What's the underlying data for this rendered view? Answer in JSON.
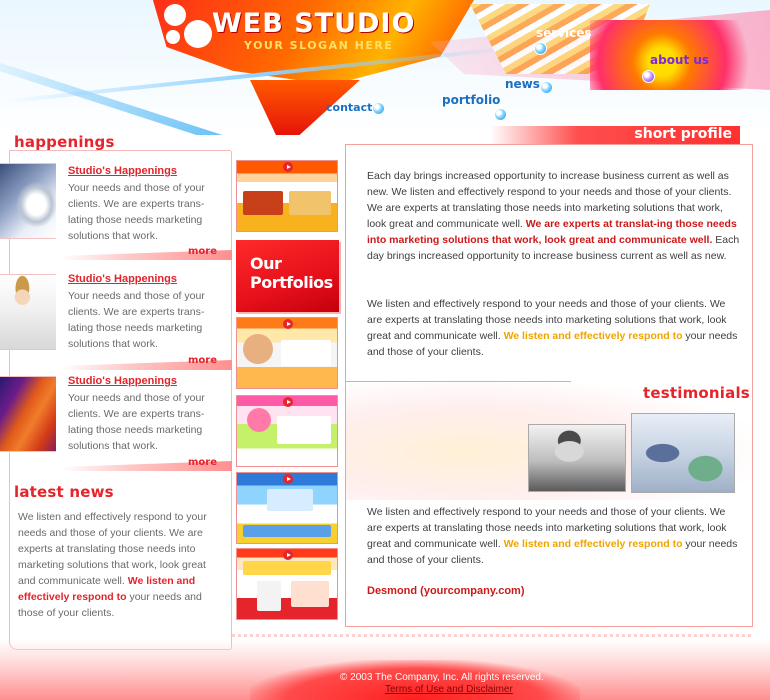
{
  "logo": {
    "title": "WEB STUDIO",
    "slogan": "YOUR SLOGAN HERE"
  },
  "nav": {
    "services": "services",
    "about_us": "about us",
    "news": "news",
    "portfolio": "portfolio",
    "contact": "contact"
  },
  "short_profile": {
    "heading": "short profile",
    "para1_a": "Each day brings increased opportunity to increase business current as well as new.  We listen and effectively respond to your needs and those of your clients. We are experts at translating those needs into marketing solutions that work, look great and communicate well.  ",
    "para1_b": "We are experts at translat-ing  those needs into marketing solutions that work, look great and communicate well.",
    "para1_c": " Each day brings increased opportunity to increase business current as well as new.",
    "para2_a": "We listen and effectively respond to your needs and those of your clients. We are experts at translating those needs into marketing solutions that work, look great and communicate well.  ",
    "para2_b": "We listen and effectively respond to",
    "para2_c": " your needs and those of your clients."
  },
  "testimonials": {
    "heading": "testimonials",
    "text_a": "We listen and effectively respond to your needs and those of your clients. We are experts at translating those needs into marketing solutions that work, look great and communicate well.  ",
    "text_b": "We listen and effectively respond to",
    "text_c": " your needs and those of your clients.",
    "signature": "Desmond (yourcompany.com)"
  },
  "happenings": {
    "heading": "happenings",
    "items": [
      {
        "title": "Studio's Happenings",
        "text": "Your needs and those of your clients. We are experts trans-lating those needs marketing solutions that work.",
        "more": "more"
      },
      {
        "title": "Studio's Happenings",
        "text": "Your needs and those of your clients. We are experts trans-lating those needs marketing solutions that work.",
        "more": "more"
      },
      {
        "title": "Studio's Happenings",
        "text": "Your needs and those of your clients. We are experts trans-lating those needs marketing solutions that work.",
        "more": "more"
      }
    ]
  },
  "latest_news": {
    "heading": "latest news",
    "text_a": "We listen and effectively respond to your needs and those of your clients. We are experts at translating those needs into marketing solutions that work, look great and communicate well.  ",
    "text_b": "We listen and effectively respond to",
    "text_c": " your needs and those of your clients."
  },
  "portfolios": {
    "label_line1": "Our",
    "label_line2": "Portfolios"
  },
  "footer": {
    "copyright": "© 2003 The Company, Inc. All rights reserved.",
    "terms": "Terms of Use and Disclaimer"
  },
  "colors": {
    "accent": "#e5242b",
    "highlight": "#f0a400",
    "nav_blue": "#1b6fc2"
  }
}
